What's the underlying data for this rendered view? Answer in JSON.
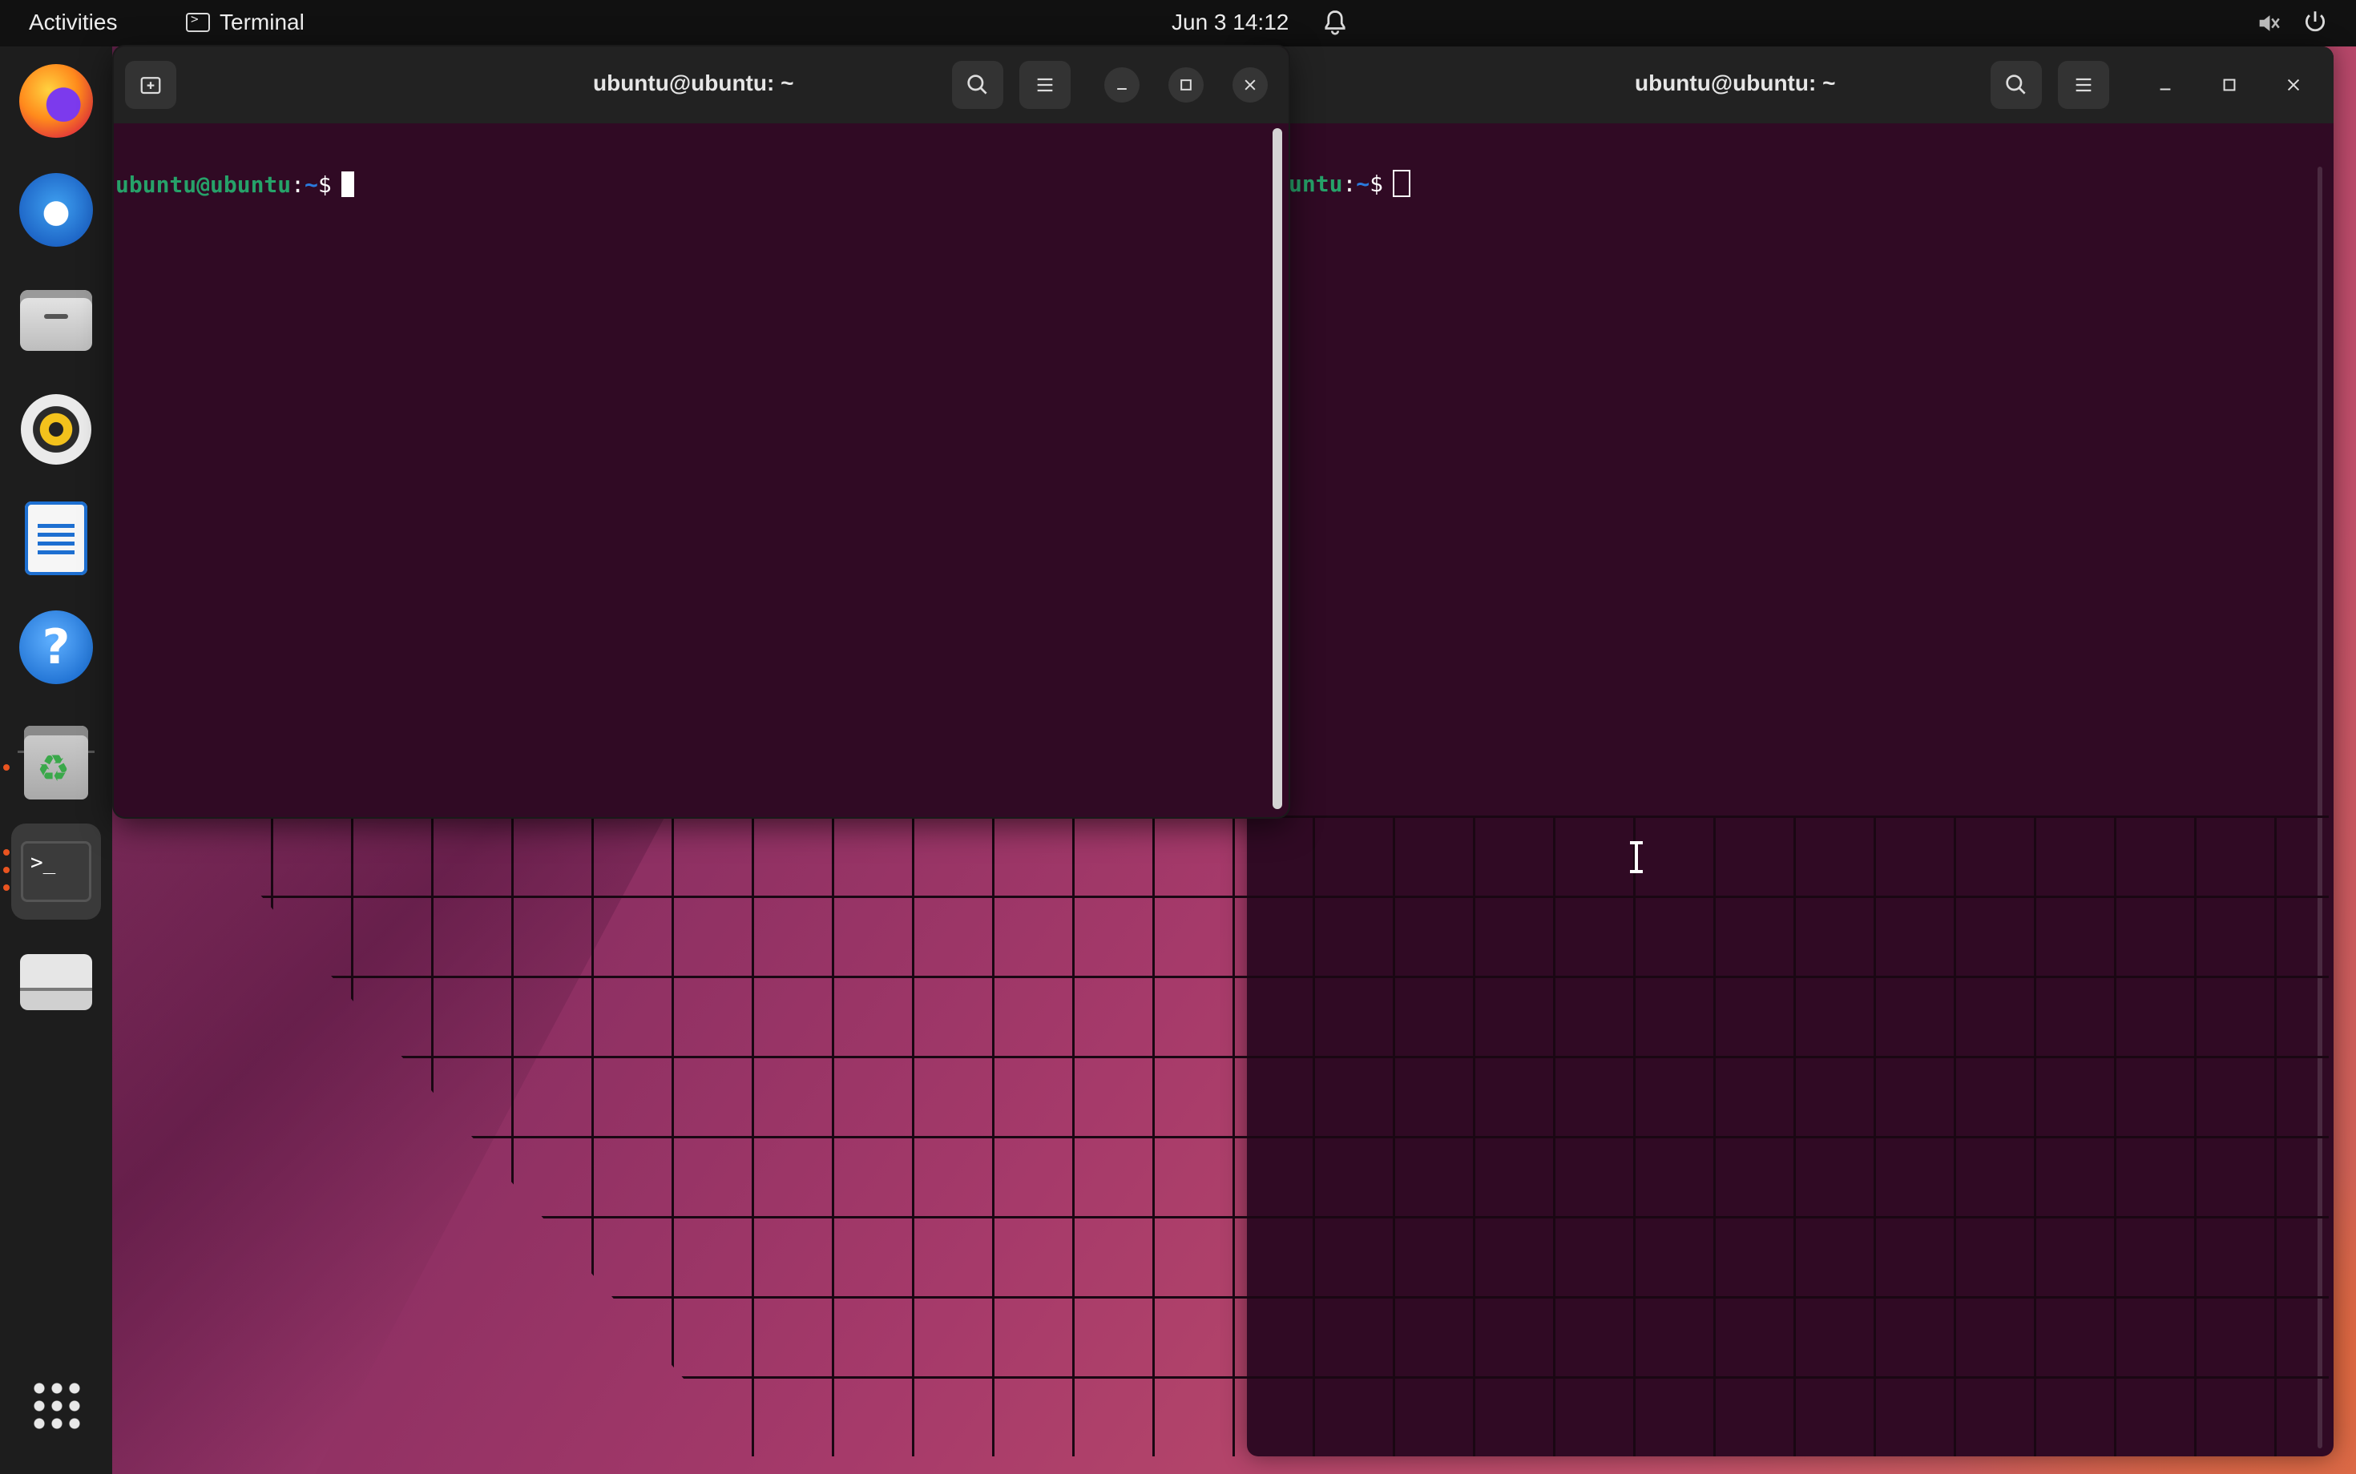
{
  "topbar": {
    "activities": "Activities",
    "app_name": "Terminal",
    "clock": "Jun 3  14:12"
  },
  "dock": {
    "items": [
      {
        "name": "firefox",
        "icon": "firefox-icon"
      },
      {
        "name": "thunderbird",
        "icon": "thunderbird-icon"
      },
      {
        "name": "files",
        "icon": "files-icon"
      },
      {
        "name": "rhythmbox",
        "icon": "rhythmbox-icon"
      },
      {
        "name": "writer",
        "icon": "libreoffice-writer-icon"
      },
      {
        "name": "help",
        "icon": "help-icon"
      },
      {
        "name": "trash",
        "icon": "trash-icon"
      },
      {
        "name": "terminal",
        "icon": "terminal-icon"
      },
      {
        "name": "drive",
        "icon": "drive-icon"
      },
      {
        "name": "show-apps",
        "icon": "app-grid-icon"
      }
    ]
  },
  "front_terminal": {
    "title": "ubuntu@ubuntu: ~",
    "prompt_user": "ubuntu@ubuntu",
    "prompt_sep": ":",
    "prompt_path": "~",
    "prompt_symbol": "$"
  },
  "back_terminal": {
    "title": "ubuntu@ubuntu: ~",
    "prompt_user_partial": "untu",
    "prompt_sep": ":",
    "prompt_path": "~",
    "prompt_symbol": "$"
  },
  "colors": {
    "terminal_bg": "#300a24",
    "headerbar_bg": "#222222",
    "prompt_user": "#26a269",
    "prompt_path": "#2a7bde",
    "accent": "#e95420"
  }
}
